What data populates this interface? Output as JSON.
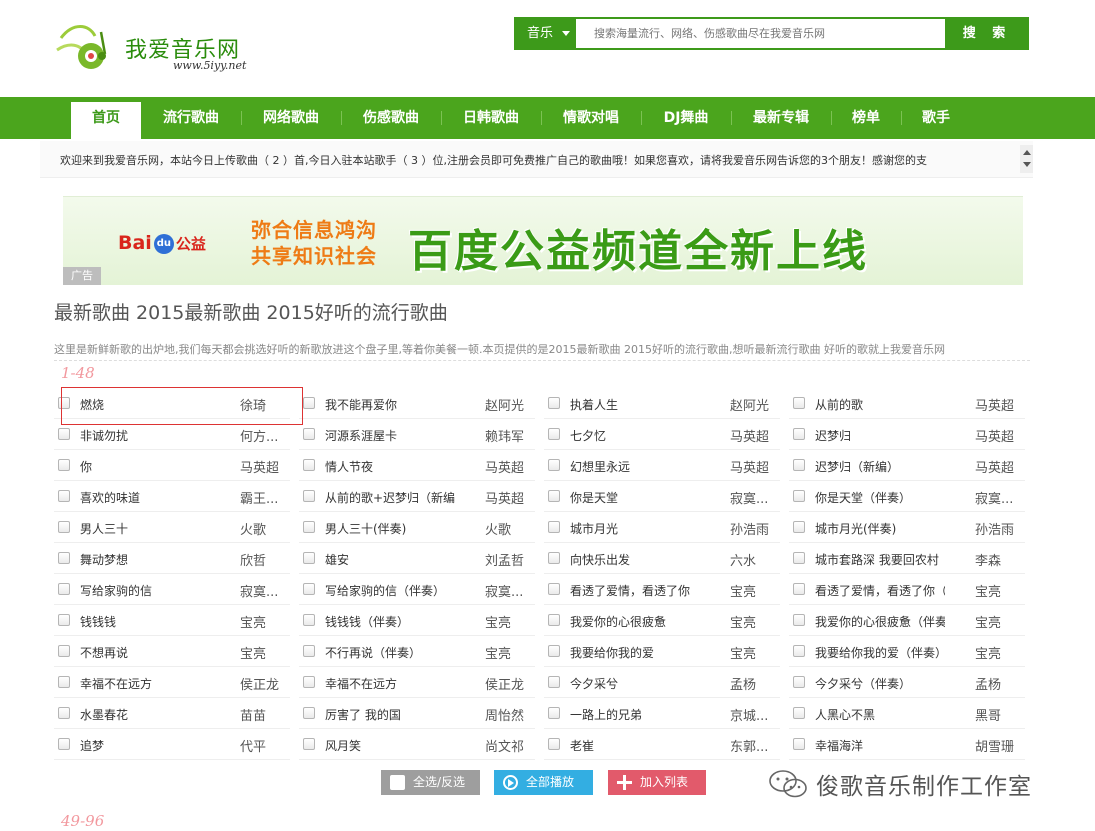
{
  "logo": {
    "name": "我爱音乐网",
    "url": "www.5iyy.net"
  },
  "search": {
    "category": "音乐",
    "placeholder": "搜索海量流行、网络、伤感歌曲尽在我爱音乐网",
    "button": "搜 索"
  },
  "nav": [
    "首页",
    "流行歌曲",
    "网络歌曲",
    "伤感歌曲",
    "日韩歌曲",
    "情歌对唱",
    "DJ舞曲",
    "最新专辑",
    "榜单",
    "歌手"
  ],
  "nav_active": "首页",
  "notice": "欢迎来到我爱音乐网，本站今日上传歌曲（ 2 ）首,今日入驻本站歌手（ 3 ）位,注册会员即可免费推广自己的歌曲哦！如果您喜欢，请将我爱音乐网告诉您的3个朋友！感谢您的支",
  "banner": {
    "brand": "Bai",
    "brand_du": "du",
    "brand_suffix": "公益",
    "slogan_line1": "弥合信息鸿沟",
    "slogan_line2": "共享知识社会",
    "headline": "百度公益频道全新上线",
    "ad_tag": "广告"
  },
  "page_title": "最新歌曲 2015最新歌曲 2015好听的流行歌曲",
  "intro": "这里是新鲜新歌的出炉地,我们每天都会挑选好听的新歌放进这个盘子里,等着你美餐一顿.本页提供的是2015最新歌曲 2015好听的流行歌曲,想听最新流行歌曲 好听的歌就上我爱音乐网",
  "range1": "1-48",
  "range2": "49-96",
  "songs": [
    [
      {
        "name": "燃烧",
        "artist": "徐琦"
      },
      {
        "name": "非诚勿扰",
        "artist": "何方..."
      },
      {
        "name": "你",
        "artist": "马英超"
      },
      {
        "name": "喜欢的味道",
        "artist": "霸王..."
      },
      {
        "name": "男人三十",
        "artist": "火歌"
      },
      {
        "name": "舞动梦想",
        "artist": "欣哲"
      },
      {
        "name": "写给家驹的信",
        "artist": "寂寞..."
      },
      {
        "name": "钱钱钱",
        "artist": "宝亮"
      },
      {
        "name": "不想再说",
        "artist": "宝亮"
      },
      {
        "name": "幸福不在远方",
        "artist": "侯正龙"
      },
      {
        "name": "水墨春花",
        "artist": "苗苗"
      },
      {
        "name": "追梦",
        "artist": "代平"
      }
    ],
    [
      {
        "name": "我不能再爱你",
        "artist": "赵阿光"
      },
      {
        "name": "河源系涯屋卡",
        "artist": "赖玮军"
      },
      {
        "name": "情人节夜",
        "artist": "马英超"
      },
      {
        "name": "从前的歌+迟梦归（新编）",
        "artist": "马英超"
      },
      {
        "name": "男人三十(伴奏)",
        "artist": "火歌"
      },
      {
        "name": "雄安",
        "artist": "刘孟哲"
      },
      {
        "name": "写给家驹的信（伴奏）",
        "artist": "寂寞..."
      },
      {
        "name": "钱钱钱（伴奏）",
        "artist": "宝亮"
      },
      {
        "name": "不行再说（伴奏）",
        "artist": "宝亮"
      },
      {
        "name": "幸福不在远方",
        "artist": "侯正龙"
      },
      {
        "name": "厉害了 我的国",
        "artist": "周怡然"
      },
      {
        "name": "风月笑",
        "artist": "尚文祁"
      }
    ],
    [
      {
        "name": "执着人生",
        "artist": "赵阿光"
      },
      {
        "name": "七夕忆",
        "artist": "马英超"
      },
      {
        "name": "幻想里永远",
        "artist": "马英超"
      },
      {
        "name": "你是天堂",
        "artist": "寂寞..."
      },
      {
        "name": "城市月光",
        "artist": "孙浩雨"
      },
      {
        "name": "向快乐出发",
        "artist": "六水"
      },
      {
        "name": "看透了爱情，看透了你",
        "artist": "宝亮"
      },
      {
        "name": "我爱你的心很疲惫",
        "artist": "宝亮"
      },
      {
        "name": "我要给你我的爱",
        "artist": "宝亮"
      },
      {
        "name": "今夕采兮",
        "artist": "孟杨"
      },
      {
        "name": "一路上的兄弟",
        "artist": "京城..."
      },
      {
        "name": "老崔",
        "artist": "东郭..."
      }
    ],
    [
      {
        "name": "从前的歌",
        "artist": "马英超"
      },
      {
        "name": "迟梦归",
        "artist": "马英超"
      },
      {
        "name": "迟梦归（新编）",
        "artist": "马英超"
      },
      {
        "name": "你是天堂（伴奏）",
        "artist": "寂寞..."
      },
      {
        "name": "城市月光(伴奏)",
        "artist": "孙浩雨"
      },
      {
        "name": "城市套路深 我要回农村",
        "artist": "李森"
      },
      {
        "name": "看透了爱情，看透了你（伴...",
        "artist": "宝亮"
      },
      {
        "name": "我爱你的心很疲惫（伴奏）",
        "artist": "宝亮"
      },
      {
        "name": "我要给你我的爱（伴奏）",
        "artist": "宝亮"
      },
      {
        "name": "今夕采兮（伴奏）",
        "artist": "孟杨"
      },
      {
        "name": "人黑心不黑",
        "artist": "黑哥"
      },
      {
        "name": "幸福海洋",
        "artist": "胡雪珊"
      }
    ]
  ],
  "actions": {
    "select": "全选/反选",
    "play": "全部播放",
    "add": "加入列表"
  },
  "watermark": "俊歌音乐制作工作室",
  "colors": {
    "brand_green": "#4ba51d",
    "dark_green": "#3d9a1a",
    "highlight_red": "#dd3333",
    "range_pink": "#f2989e"
  }
}
